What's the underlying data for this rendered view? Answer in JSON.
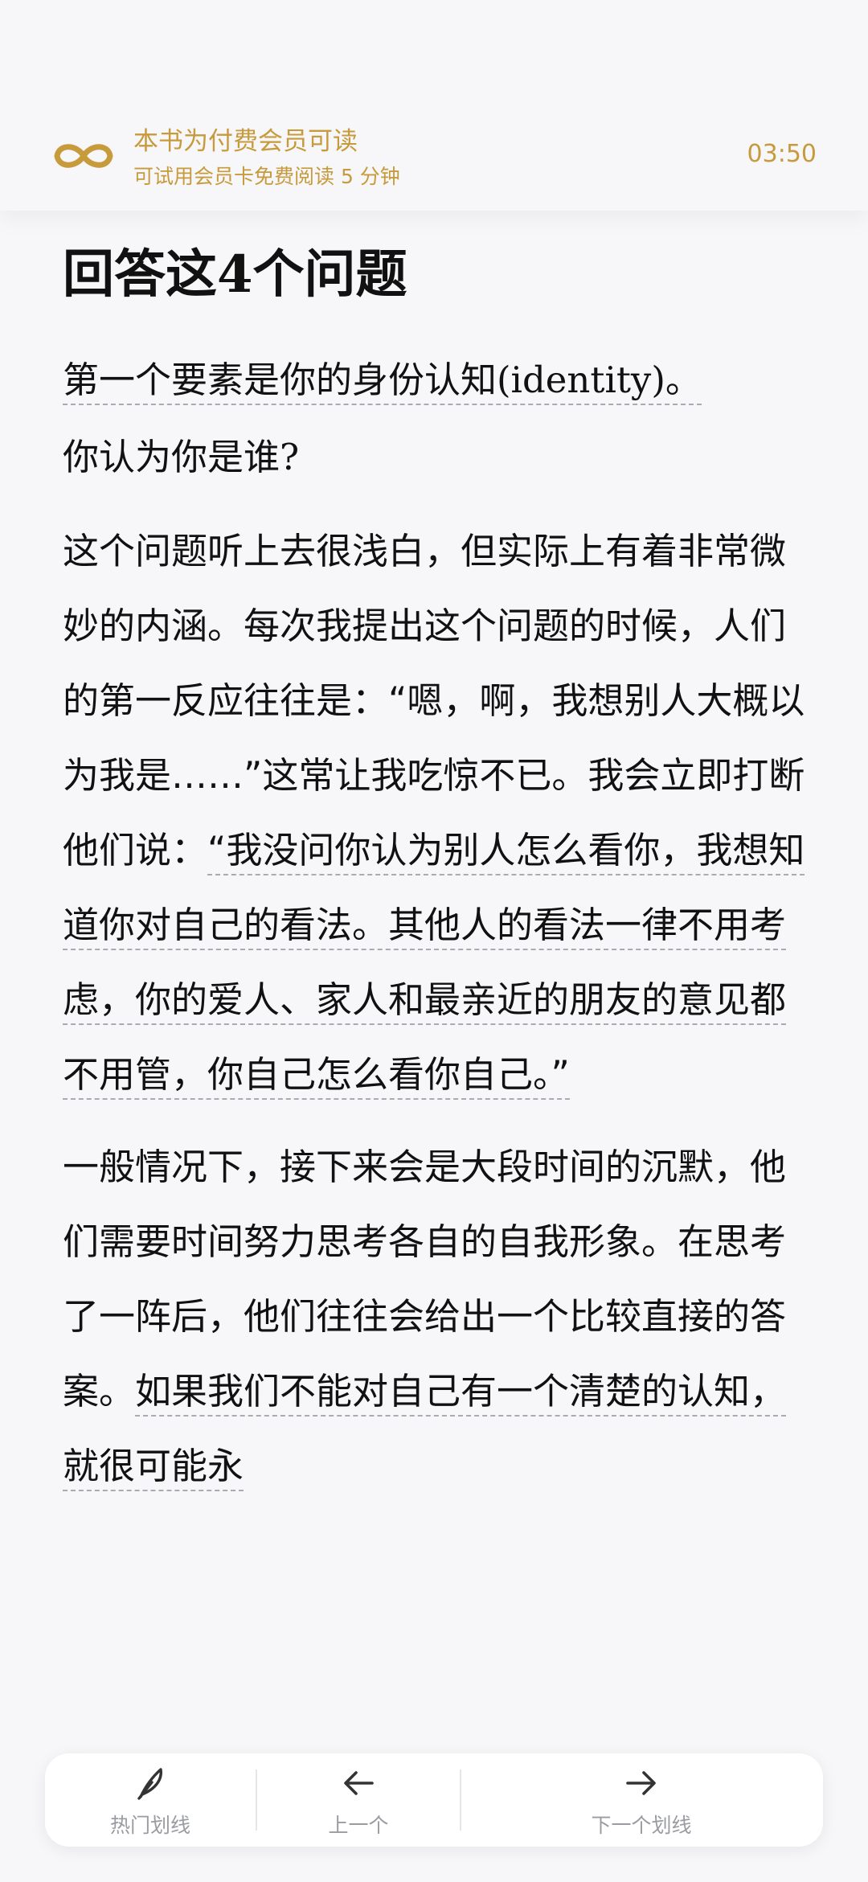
{
  "banner": {
    "icon": "infinity-icon",
    "title": "本书为付费会员可读",
    "subtitle": "可试用会员卡免费阅读 5 分钟",
    "timer": "03:50"
  },
  "article": {
    "title": "回答这4个问题",
    "p1_underlined": "第一个要素是你的身份认知(identity)。",
    "p1_rest": "你认为你是谁?",
    "p2_plain": "这个问题听上去很浅白，但实际上有着非常微妙的内涵。每次我提出这个问题的时候，人们的第一反应往往是：“嗯，啊，我想别人大概以为我是……”这常让我吃惊不已。我会立即打断他们说：",
    "p2_underlined": "“我没问你认为别人怎么看你，我想知道你对自己的看法。其他人的看法一律不用考虑，你的爱人、家人和最亲近的朋友的意见都不用管，你自己怎么看你自己。”",
    "p3_plain": "一般情况下，接下来会是大段时间的沉默，他们需要时间努力思考各自的自我形象。在思考了一阵后，他们往往会给出一个比较直接的答案。",
    "p3_underlined": "如果我们不能对自己有一个清楚的认知，就很可能永"
  },
  "bottom_nav": {
    "hot_label": "热门划线",
    "hot_icon": "feather-icon",
    "prev_label": "上一个",
    "prev_icon": "arrow-left-icon",
    "next_label": "下一个划线",
    "next_icon": "arrow-right-icon"
  },
  "colors": {
    "accent": "#c79a3c",
    "text": "#111111",
    "muted": "#9a9ca2",
    "background": "#f7f7f9"
  }
}
